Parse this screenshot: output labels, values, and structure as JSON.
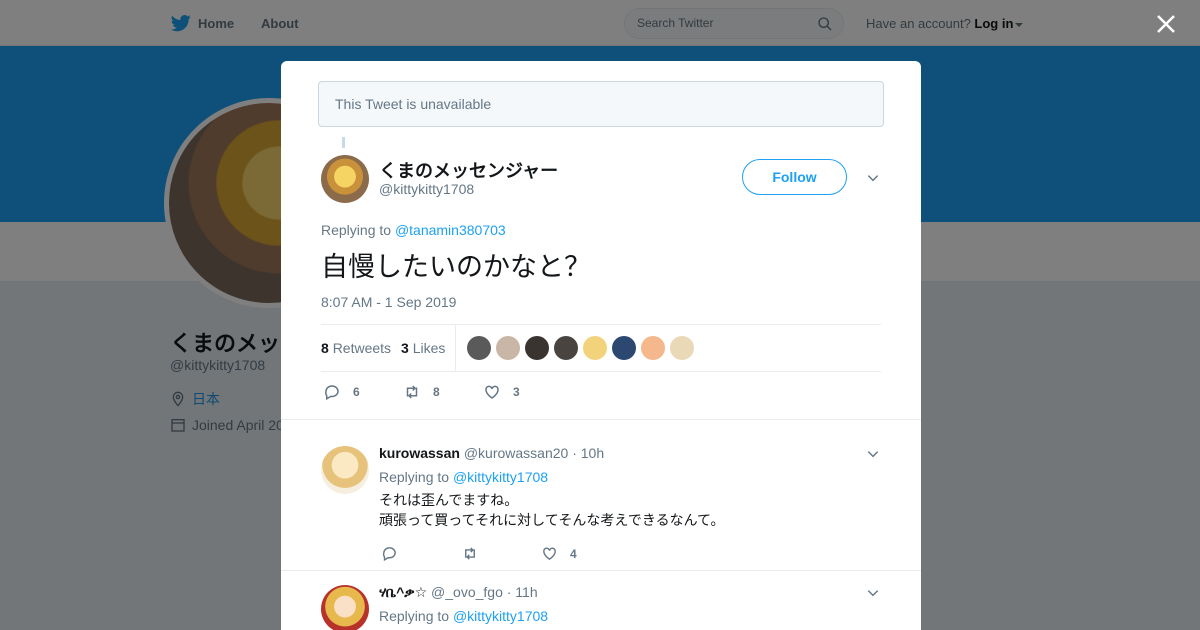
{
  "nav": {
    "home_label": "Home",
    "about_label": "About",
    "search_placeholder": "Search Twitter",
    "have_account": "Have an account?",
    "login_label": "Log in"
  },
  "background_profile": {
    "name": "くまのメッ",
    "handle": "@kittykitty1708",
    "location": "日本",
    "joined": "Joined April 20"
  },
  "modal": {
    "unavailable_text": "This Tweet is unavailable",
    "tweet": {
      "author_name": "くまのメッセンジャー",
      "author_handle": "@kittykitty1708",
      "follow_label": "Follow",
      "replying_prefix": "Replying to",
      "replying_handle": "@tanamin380703",
      "text": "自慢したいのかなと？",
      "timestamp": "8:07 AM - 1 Sep 2019",
      "retweets_count": "8",
      "retweets_label": "Retweets",
      "likes_count": "3",
      "likes_label": "Likes",
      "reply_count": "6",
      "retweet_action_count": "8",
      "like_action_count": "3"
    },
    "replies": [
      {
        "name": "kurowassan",
        "handle": "@kurowassan20",
        "time": "· 10h",
        "replying_prefix": "Replying to",
        "replying_handle": "@kittykitty1708",
        "line1": "それは歪んでますね。",
        "line2": "頑張って買ってそれに対してそんな考えできるなんて。",
        "like_count": "4"
      },
      {
        "name": "ሃቤ^ቃ☆",
        "handle": "@_ovo_fgo",
        "time": "· 11h",
        "replying_prefix": "Replying to",
        "replying_handle": "@kittykitty1708"
      }
    ]
  },
  "colors": {
    "accent": "#1da1f2",
    "banner": "#1da1f2",
    "text_secondary": "#657786",
    "overlay": "rgba(0,0,0,0.5)"
  },
  "icons": [
    "twitter-bird-icon",
    "search-icon",
    "close-icon",
    "chevron-down-icon",
    "reply-icon",
    "retweet-icon",
    "like-icon",
    "location-icon",
    "calendar-icon"
  ]
}
